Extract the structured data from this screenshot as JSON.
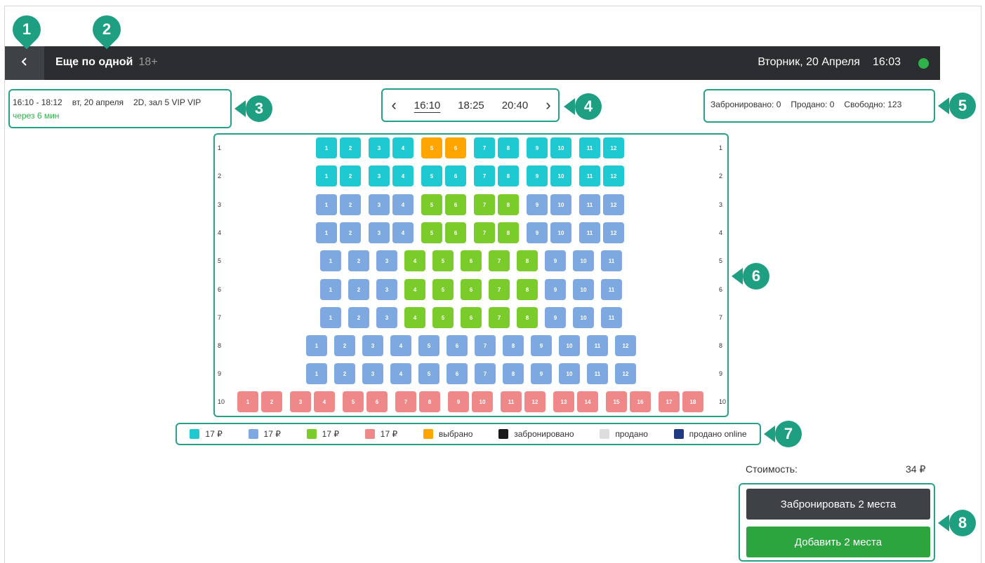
{
  "header": {
    "back_icon": "chevron-left-icon",
    "movie_title": "Еще по одной",
    "age_rating": "18+",
    "date": "Вторник, 20 Апреля",
    "time": "16:03",
    "status_color": "#2fb24a"
  },
  "session": {
    "time_range": "16:10 - 18:12",
    "date": "вт, 20 апреля",
    "hall": "2D, зал 5 VIP VIP",
    "starts_in": "через 6 мин"
  },
  "time_nav": {
    "prev_icon": "chevron-left-icon",
    "next_icon": "chevron-right-icon",
    "times": [
      "16:10",
      "18:25",
      "20:40"
    ],
    "active": "16:10"
  },
  "stats": {
    "reserved": "Забронировано: 0",
    "sold": "Продано: 0",
    "free": "Свободно: 123"
  },
  "seatmap": {
    "row_labels": [
      "1",
      "2",
      "3",
      "4",
      "5",
      "6",
      "7",
      "8",
      "9",
      "10"
    ],
    "rows": [
      {
        "row": "1",
        "seats": [
          [
            "1",
            "teal"
          ],
          [
            "2",
            "teal"
          ],
          [
            "3",
            "teal"
          ],
          [
            "4",
            "teal"
          ],
          [
            "5",
            "sel"
          ],
          [
            "6",
            "sel"
          ],
          [
            "7",
            "teal"
          ],
          [
            "8",
            "teal"
          ],
          [
            "9",
            "teal"
          ],
          [
            "10",
            "teal"
          ],
          [
            "11",
            "teal"
          ],
          [
            "12",
            "teal"
          ]
        ]
      },
      {
        "row": "2",
        "seats": [
          [
            "1",
            "teal"
          ],
          [
            "2",
            "teal"
          ],
          [
            "3",
            "teal"
          ],
          [
            "4",
            "teal"
          ],
          [
            "5",
            "teal"
          ],
          [
            "6",
            "teal"
          ],
          [
            "7",
            "teal"
          ],
          [
            "8",
            "teal"
          ],
          [
            "9",
            "teal"
          ],
          [
            "10",
            "teal"
          ],
          [
            "11",
            "teal"
          ],
          [
            "12",
            "teal"
          ]
        ]
      },
      {
        "row": "3",
        "seats": [
          [
            "1",
            "blue"
          ],
          [
            "2",
            "blue"
          ],
          [
            "3",
            "blue"
          ],
          [
            "4",
            "blue"
          ],
          [
            "5",
            "green"
          ],
          [
            "6",
            "green"
          ],
          [
            "7",
            "green"
          ],
          [
            "8",
            "green"
          ],
          [
            "9",
            "blue"
          ],
          [
            "10",
            "blue"
          ],
          [
            "11",
            "blue"
          ],
          [
            "12",
            "blue"
          ]
        ]
      },
      {
        "row": "4",
        "seats": [
          [
            "1",
            "blue"
          ],
          [
            "2",
            "blue"
          ],
          [
            "3",
            "blue"
          ],
          [
            "4",
            "blue"
          ],
          [
            "5",
            "green"
          ],
          [
            "6",
            "green"
          ],
          [
            "7",
            "green"
          ],
          [
            "8",
            "green"
          ],
          [
            "9",
            "blue"
          ],
          [
            "10",
            "blue"
          ],
          [
            "11",
            "blue"
          ],
          [
            "12",
            "blue"
          ]
        ]
      },
      {
        "row": "5",
        "seats": [
          [
            "1",
            "blue"
          ],
          [
            "2",
            "blue"
          ],
          [
            "3",
            "blue"
          ],
          [
            "4",
            "green"
          ],
          [
            "5",
            "green"
          ],
          [
            "6",
            "green"
          ],
          [
            "7",
            "green"
          ],
          [
            "8",
            "green"
          ],
          [
            "9",
            "blue"
          ],
          [
            "10",
            "blue"
          ],
          [
            "11",
            "blue"
          ]
        ]
      },
      {
        "row": "6",
        "seats": [
          [
            "1",
            "blue"
          ],
          [
            "2",
            "blue"
          ],
          [
            "3",
            "blue"
          ],
          [
            "4",
            "green"
          ],
          [
            "5",
            "green"
          ],
          [
            "6",
            "green"
          ],
          [
            "7",
            "green"
          ],
          [
            "8",
            "green"
          ],
          [
            "9",
            "blue"
          ],
          [
            "10",
            "blue"
          ],
          [
            "11",
            "blue"
          ]
        ]
      },
      {
        "row": "7",
        "seats": [
          [
            "1",
            "blue"
          ],
          [
            "2",
            "blue"
          ],
          [
            "3",
            "blue"
          ],
          [
            "4",
            "green"
          ],
          [
            "5",
            "green"
          ],
          [
            "6",
            "green"
          ],
          [
            "7",
            "green"
          ],
          [
            "8",
            "green"
          ],
          [
            "9",
            "blue"
          ],
          [
            "10",
            "blue"
          ],
          [
            "11",
            "blue"
          ]
        ]
      },
      {
        "row": "8",
        "seats": [
          [
            "1",
            "blue"
          ],
          [
            "2",
            "blue"
          ],
          [
            "3",
            "blue"
          ],
          [
            "4",
            "blue"
          ],
          [
            "5",
            "blue"
          ],
          [
            "6",
            "blue"
          ],
          [
            "7",
            "blue"
          ],
          [
            "8",
            "blue"
          ],
          [
            "9",
            "blue"
          ],
          [
            "10",
            "blue"
          ],
          [
            "11",
            "blue"
          ],
          [
            "12",
            "blue"
          ]
        ]
      },
      {
        "row": "9",
        "seats": [
          [
            "1",
            "blue"
          ],
          [
            "2",
            "blue"
          ],
          [
            "3",
            "blue"
          ],
          [
            "4",
            "blue"
          ],
          [
            "5",
            "blue"
          ],
          [
            "6",
            "blue"
          ],
          [
            "7",
            "blue"
          ],
          [
            "8",
            "blue"
          ],
          [
            "9",
            "blue"
          ],
          [
            "10",
            "blue"
          ],
          [
            "11",
            "blue"
          ],
          [
            "12",
            "blue"
          ]
        ]
      },
      {
        "row": "10",
        "seats": [
          [
            "1",
            "red"
          ],
          [
            "2",
            "red"
          ],
          [
            "3",
            "red"
          ],
          [
            "4",
            "red"
          ],
          [
            "5",
            "red"
          ],
          [
            "6",
            "red"
          ],
          [
            "7",
            "red"
          ],
          [
            "8",
            "red"
          ],
          [
            "9",
            "red"
          ],
          [
            "10",
            "red"
          ],
          [
            "11",
            "red"
          ],
          [
            "12",
            "red"
          ],
          [
            "13",
            "red"
          ],
          [
            "14",
            "red"
          ],
          [
            "15",
            "red"
          ],
          [
            "16",
            "red"
          ],
          [
            "17",
            "red"
          ],
          [
            "18",
            "red"
          ]
        ]
      }
    ]
  },
  "legend": [
    {
      "label": "17 ₽",
      "color": "#1ec9d2"
    },
    {
      "label": "17 ₽",
      "color": "#7da9e0"
    },
    {
      "label": "17 ₽",
      "color": "#79cc2a"
    },
    {
      "label": "17 ₽",
      "color": "#ee8889"
    },
    {
      "label": "выбрано",
      "color": "#ffa500"
    },
    {
      "label": "забронировано",
      "color": "#1a1a1a"
    },
    {
      "label": "продано",
      "color": "#dddddd"
    },
    {
      "label": "продано online",
      "color": "#1f3a80"
    }
  ],
  "cost": {
    "label": "Стоимость:",
    "value": "34 ₽"
  },
  "actions": {
    "reserve": "Забронировать 2 места",
    "add": "Добавить 2 места"
  },
  "callouts": [
    "1",
    "2",
    "3",
    "4",
    "5",
    "6",
    "7",
    "8"
  ],
  "accent_color": "#1f9f82"
}
